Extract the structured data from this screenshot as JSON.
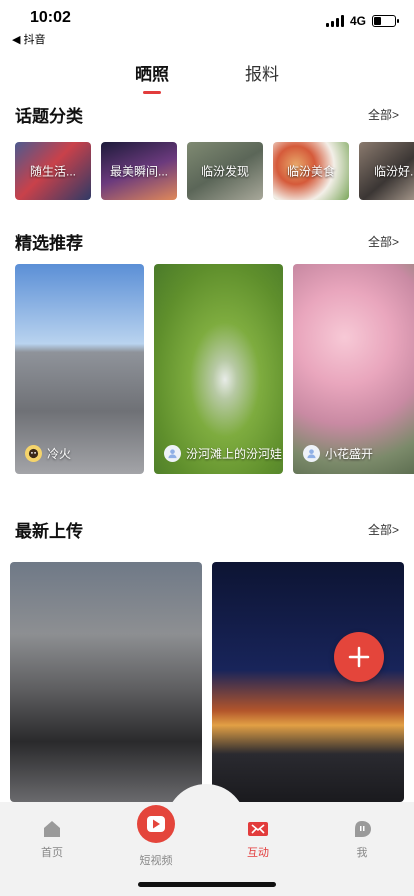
{
  "status": {
    "time": "10:02",
    "back_app": "抖音",
    "network": "4G",
    "battery_level": 0.35
  },
  "tabs": [
    {
      "label": "晒照",
      "active": true
    },
    {
      "label": "报料",
      "active": false
    }
  ],
  "topics": {
    "title": "话题分类",
    "more": "全部>",
    "items": [
      {
        "label": "随生活..."
      },
      {
        "label": "最美瞬间..."
      },
      {
        "label": "临汾发现"
      },
      {
        "label": "临汾美食"
      },
      {
        "label": "临汾好..."
      }
    ]
  },
  "featured": {
    "title": "精选推荐",
    "more": "全部>",
    "items": [
      {
        "author": "冷火"
      },
      {
        "author": "汾河滩上的汾河娃"
      },
      {
        "author": "小花盛开"
      }
    ]
  },
  "uploads": {
    "title": "最新上传",
    "more": "全部>"
  },
  "tabbar": {
    "items": [
      {
        "label": "首页"
      },
      {
        "label": "短视频"
      },
      {
        "label": "互动",
        "active": true
      },
      {
        "label": "我"
      }
    ]
  },
  "colors": {
    "accent": "#e23c3c",
    "fab": "#e4453b"
  }
}
